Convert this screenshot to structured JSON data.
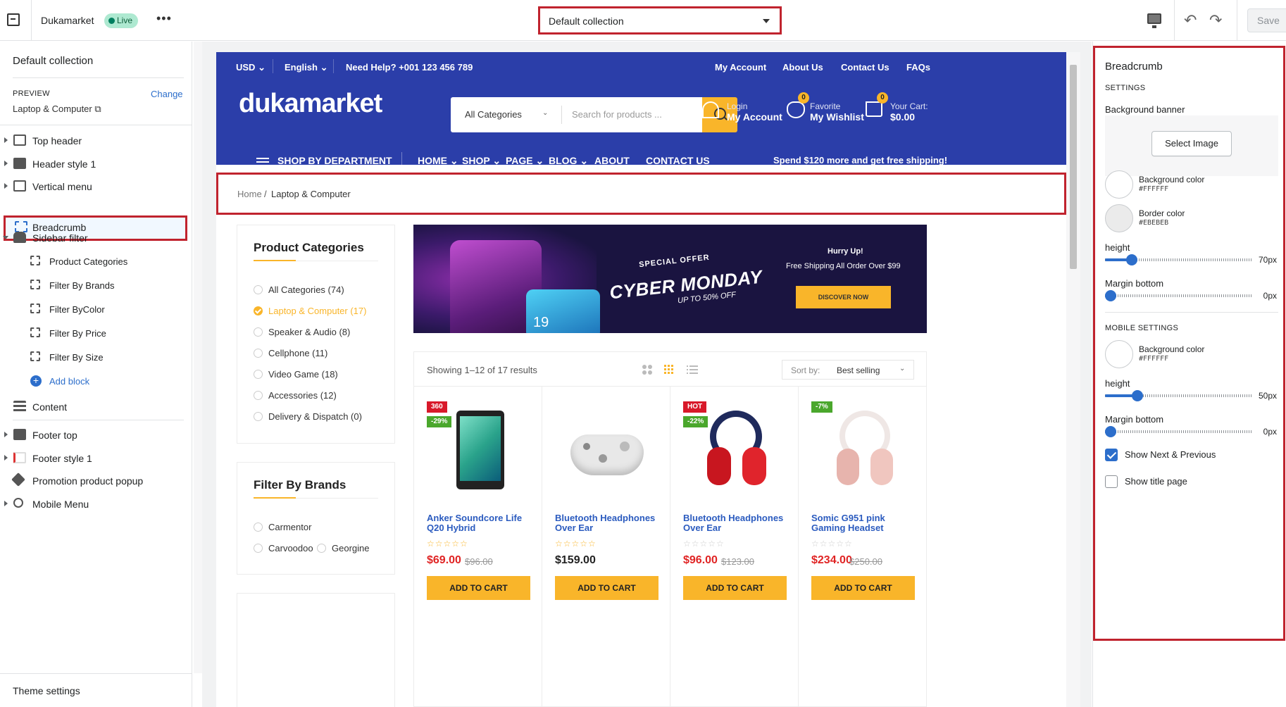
{
  "topbar": {
    "store_name": "Dukamarket",
    "status": "Live",
    "more": "•••",
    "template_select": "Default collection",
    "save": "Save"
  },
  "left_panel": {
    "title": "Default collection",
    "preview_label": "PREVIEW",
    "change_label": "Change",
    "preview_value": "Laptop & Computer",
    "sections": [
      {
        "label": "Top header"
      },
      {
        "label": "Header style 1"
      },
      {
        "label": "Vertical menu"
      },
      {
        "label": "Breadcrumb"
      },
      {
        "label": "Sidebar filter"
      }
    ],
    "blocks": [
      {
        "label": "Product Categories"
      },
      {
        "label": "Filter By Brands"
      },
      {
        "label": "Filter ByColor"
      },
      {
        "label": "Filter By Price"
      },
      {
        "label": "Filter By Size"
      }
    ],
    "add_block": "Add block",
    "content": "Content",
    "footer_sections": [
      {
        "label": "Footer top"
      },
      {
        "label": "Footer style 1"
      },
      {
        "label": "Promotion product popup"
      },
      {
        "label": "Mobile Menu"
      }
    ],
    "theme_settings": "Theme settings"
  },
  "site": {
    "util_left": [
      {
        "label": "USD"
      },
      {
        "label": "English"
      },
      {
        "label": "Need Help? +001 123 456 789"
      }
    ],
    "util_right": [
      {
        "label": "My Account"
      },
      {
        "label": "About Us"
      },
      {
        "label": "Contact Us"
      },
      {
        "label": "FAQs"
      }
    ],
    "logo": "dukamarket",
    "search": {
      "category": "All Categories",
      "placeholder": "Search for products ..."
    },
    "account": {
      "small": "Login",
      "big": "My Account"
    },
    "wishlist": {
      "small": "Favorite",
      "big": "My Wishlist",
      "count": "0"
    },
    "cart": {
      "small": "Your Cart:",
      "big": "$0.00",
      "count": "0"
    },
    "shop_by_department": "SHOP BY DEPARTMENT",
    "nav": [
      {
        "label": "HOME"
      },
      {
        "label": "SHOP"
      },
      {
        "label": "PAGE"
      },
      {
        "label": "BLOG"
      },
      {
        "label": "ABOUT"
      },
      {
        "label": "CONTACT US"
      }
    ],
    "promo": "Spend $120 more and get free shipping!",
    "breadcrumb": {
      "home": "Home",
      "sep": "/",
      "current": "Laptop & Computer"
    },
    "categories_title": "Product Categories",
    "categories": [
      {
        "label": "All Categories (74)",
        "active": false
      },
      {
        "label": "Laptop & Computer (17)",
        "active": true
      },
      {
        "label": "Speaker & Audio (8)",
        "active": false
      },
      {
        "label": "Cellphone (11)",
        "active": false
      },
      {
        "label": "Video Game (18)",
        "active": false
      },
      {
        "label": "Accessories (12)",
        "active": false
      },
      {
        "label": "Delivery & Dispatch (0)",
        "active": false
      }
    ],
    "brands_title": "Filter By Brands",
    "brands": [
      {
        "label": "Carmentor"
      },
      {
        "label": "Carvoodoo"
      },
      {
        "label": "Georgine"
      }
    ],
    "banner": {
      "special": "SPECIAL OFFER",
      "headline": "CYBER MONDAY",
      "upto": "UP TO 50% OFF",
      "hurry": "Hurry Up!",
      "free": "Free Shipping All Order Over $99",
      "cta": "DISCOVER NOW",
      "phone_number": "19"
    },
    "results": "Showing 1–12 of 17 results",
    "sort_label": "Sort by:",
    "sort_value": "Best selling",
    "products": [
      {
        "name": "Anker Soundcore Life Q20 Hybrid",
        "price": "$69.00",
        "old": "$96.00",
        "tags": [
          "360",
          "-29%"
        ],
        "rated": true,
        "cta": "ADD TO CART"
      },
      {
        "name": "Bluetooth Headphones Over Ear",
        "price": "$159.00",
        "old": "",
        "tags": [],
        "rated": true,
        "cta": "ADD TO CART"
      },
      {
        "name": "Bluetooth Headphones Over Ear",
        "price": "$96.00",
        "old": "$123.00",
        "tags": [
          "HOT",
          "-22%"
        ],
        "rated": false,
        "cta": "ADD TO CART"
      },
      {
        "name": "Somic G951 pink Gaming Headset",
        "price": "$234.00",
        "old": "$250.00",
        "tags": [
          "-7%"
        ],
        "rated": false,
        "cta": "ADD TO CART"
      }
    ],
    "stars": "☆☆☆☆☆"
  },
  "right_panel": {
    "title": "Breadcrumb",
    "settings": "SETTINGS",
    "bg_banner": "Background banner",
    "select_image": "Select Image",
    "bg_color_label": "Background color",
    "bg_color_hex": "#FFFFFF",
    "border_color_label": "Border color",
    "border_color_hex": "#EBEBEB",
    "height_label": "height",
    "height_value": "70px",
    "height_fraction": 0.18,
    "margin_label": "Margin bottom",
    "margin_value": "0px",
    "margin_fraction": 0,
    "mobile_settings": "MOBILE SETTINGS",
    "m_bg_color_label": "Background color",
    "m_bg_color_hex": "#FFFFFF",
    "m_height_label": "height",
    "m_height_value": "50px",
    "m_height_fraction": 0.22,
    "m_margin_label": "Margin bottom",
    "m_margin_value": "0px",
    "m_margin_fraction": 0,
    "show_next_prev": "Show Next & Previous",
    "show_next_prev_checked": true,
    "show_title": "Show title page",
    "show_title_checked": false
  },
  "colors": {
    "brand_blue": "#2b3ea9",
    "accent_yellow": "#f9b52a",
    "sale_red": "#e02424",
    "highlight_red": "#c0232e",
    "admin_blue": "#2c6ecb",
    "border_gray": "#EBEBEB"
  }
}
